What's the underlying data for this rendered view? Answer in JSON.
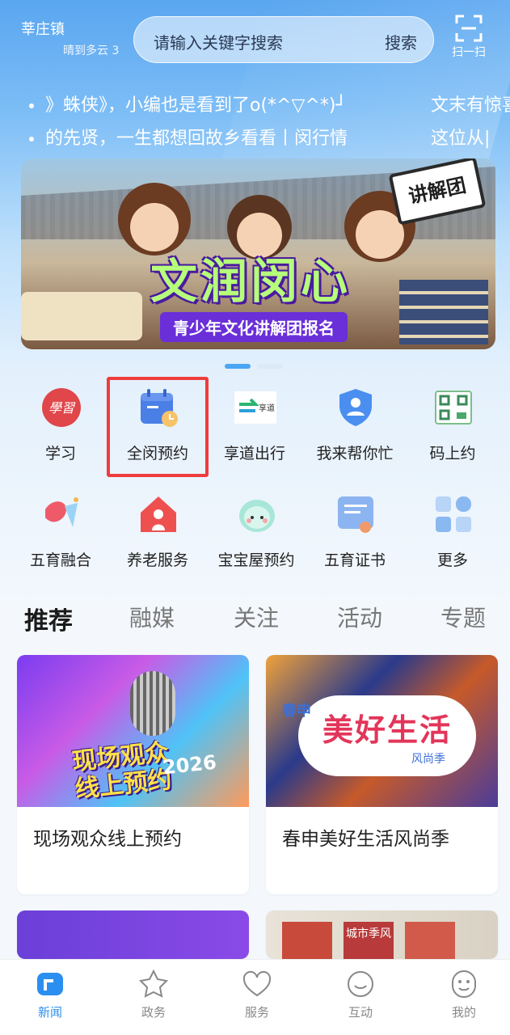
{
  "header": {
    "location": "莘庄镇",
    "weather": "晴到多云 3",
    "search_placeholder": "请输入关键字搜索",
    "search_button": "搜索",
    "scan_label": "扫一扫"
  },
  "ticker": {
    "line1_left": "》蛛侠》，小编也是看到了o(*^▽^*)┘",
    "line1_right": "文末有惊喜",
    "line2_left": "的先贤，一生都想回故乡看看丨闵行情",
    "line2_right": "这位从|"
  },
  "banner": {
    "title": "文润闵心",
    "subtitle": "青少年文化讲解团报名",
    "sign": "讲解团"
  },
  "services": [
    {
      "label": "学习",
      "icon": "study-icon"
    },
    {
      "label": "全闵预约",
      "icon": "calendar-icon"
    },
    {
      "label": "享道出行",
      "icon": "xiangdao-icon"
    },
    {
      "label": "我来帮你忙",
      "icon": "shield-user-icon"
    },
    {
      "label": "码上约",
      "icon": "qrcode-icon"
    },
    {
      "label": "五育融合",
      "icon": "five-edu-icon"
    },
    {
      "label": "养老服务",
      "icon": "house-icon"
    },
    {
      "label": "宝宝屋预约",
      "icon": "baby-icon"
    },
    {
      "label": "五育证书",
      "icon": "certificate-icon"
    },
    {
      "label": "更多",
      "icon": "grid-icon"
    }
  ],
  "xiangdao_logo_text": "享道",
  "tabs": [
    "推荐",
    "融媒",
    "关注",
    "活动",
    "专题"
  ],
  "cards": [
    {
      "title": "现场观众线上预约",
      "img_text": "现场观众\n线上预约",
      "year": "2026"
    },
    {
      "title": "春申美好生活风尚季",
      "img_text": "美好生活",
      "img_small": "春申",
      "img_foot": "风尚季"
    },
    {
      "title": "",
      "img_text": ""
    },
    {
      "title": "",
      "img_text": "城市季风"
    }
  ],
  "nav": [
    {
      "label": "新闻",
      "icon": "news-icon"
    },
    {
      "label": "政务",
      "icon": "star-icon"
    },
    {
      "label": "服务",
      "icon": "heart-icon"
    },
    {
      "label": "互动",
      "icon": "chat-icon"
    },
    {
      "label": "我的",
      "icon": "smile-icon"
    }
  ],
  "colors": {
    "accent": "#2a8ff0",
    "highlight": "#ef3c3c"
  }
}
